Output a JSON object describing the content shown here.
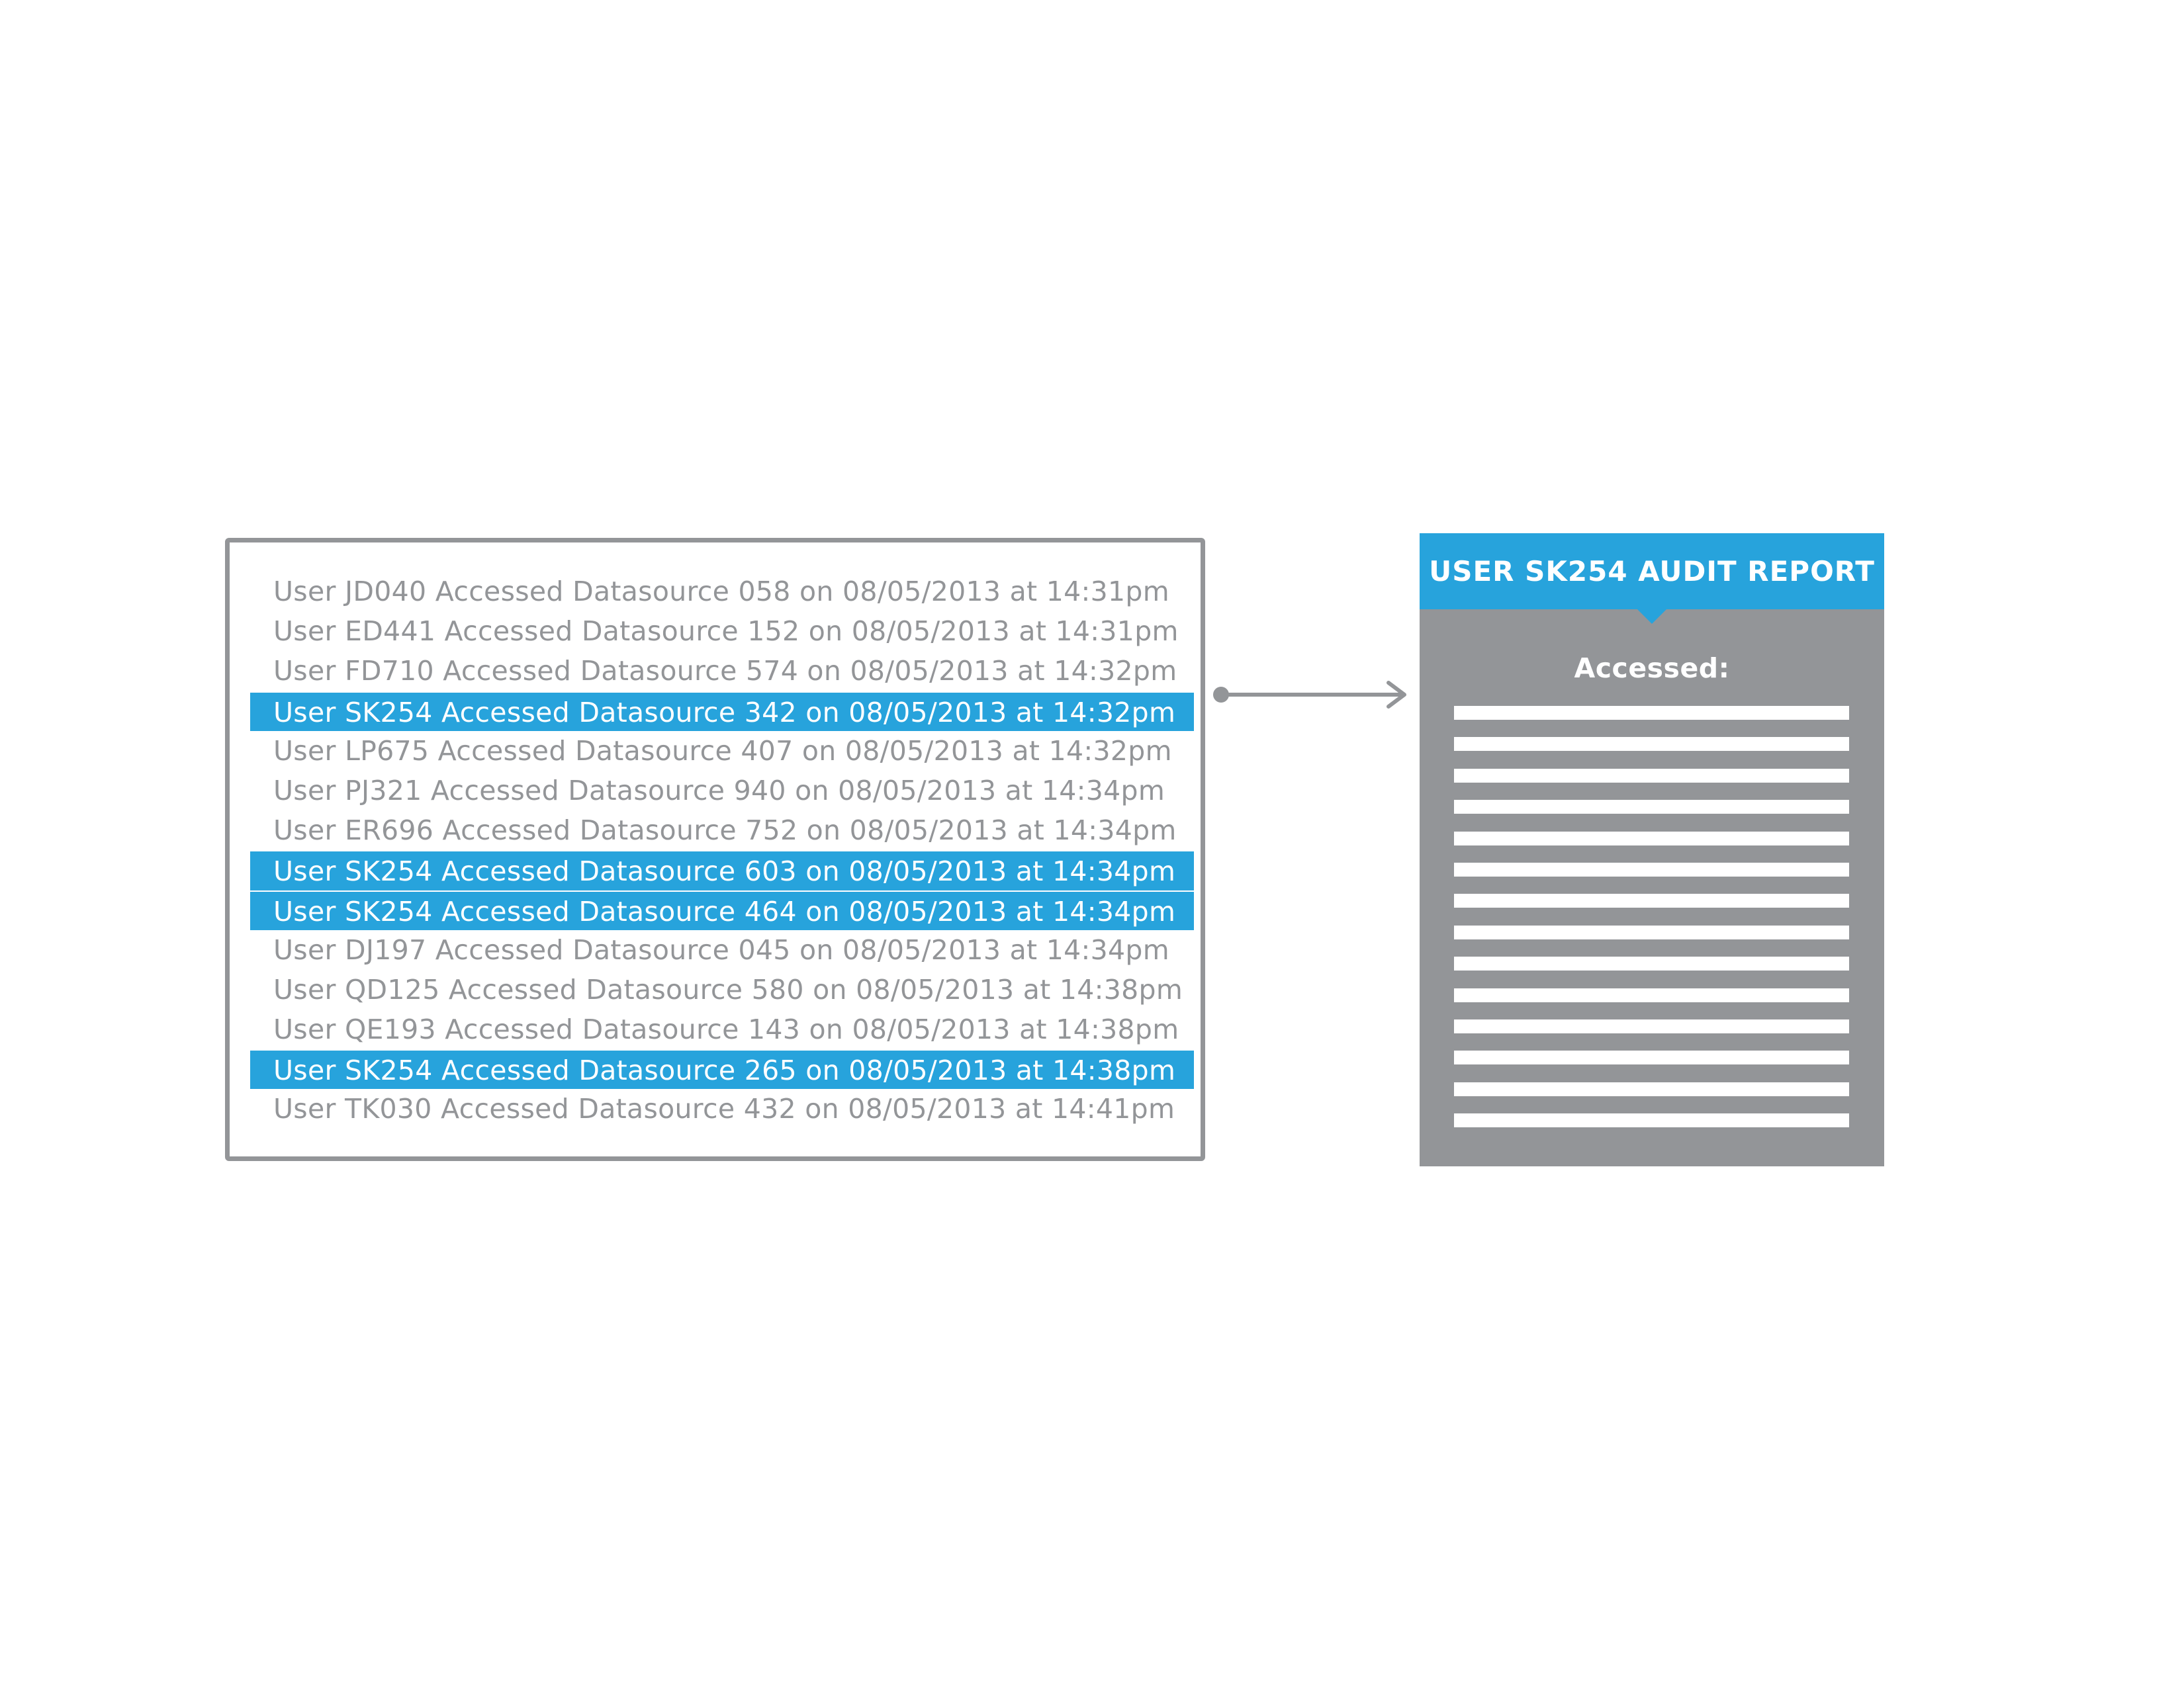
{
  "log": {
    "entries": [
      {
        "text": "User JD040 Accessed Datasource 058 on 08/05/2013 at 14:31pm",
        "highlighted": false
      },
      {
        "text": "User ED441 Accessed Datasource 152 on 08/05/2013 at 14:31pm",
        "highlighted": false
      },
      {
        "text": "User FD710 Accessed Datasource 574 on 08/05/2013 at 14:32pm",
        "highlighted": false
      },
      {
        "text": "User SK254 Accessed Datasource 342 on 08/05/2013 at 14:32pm",
        "highlighted": true
      },
      {
        "text": "User LP675 Accessed Datasource 407 on 08/05/2013 at 14:32pm",
        "highlighted": false
      },
      {
        "text": "User PJ321 Accessed Datasource 940 on 08/05/2013 at 14:34pm",
        "highlighted": false
      },
      {
        "text": "User ER696 Accessed Datasource 752 on 08/05/2013 at 14:34pm",
        "highlighted": false
      },
      {
        "text": "User SK254 Accessed Datasource 603 on 08/05/2013 at 14:34pm",
        "highlighted": true
      },
      {
        "text": "User SK254 Accessed Datasource 464 on 08/05/2013 at 14:34pm",
        "highlighted": true
      },
      {
        "text": "User DJ197 Accessed Datasource 045 on 08/05/2013 at 14:34pm",
        "highlighted": false
      },
      {
        "text": "User QD125 Accessed Datasource 580 on 08/05/2013 at 14:38pm",
        "highlighted": false
      },
      {
        "text": "User QE193 Accessed Datasource 143 on 08/05/2013 at 14:38pm",
        "highlighted": false
      },
      {
        "text": "User SK254 Accessed Datasource 265 on 08/05/2013 at 14:38pm",
        "highlighted": true
      },
      {
        "text": "User TK030 Accessed Datasource 432 on 08/05/2013 at 14:41pm",
        "highlighted": false
      }
    ]
  },
  "report": {
    "title": "USER SK254 AUDIT REPORT",
    "accessed_label": "Accessed:",
    "placeholder_line_count": 14
  },
  "colors": {
    "highlight": "#27a3dc",
    "gray": "#939598",
    "white": "#ffffff"
  }
}
